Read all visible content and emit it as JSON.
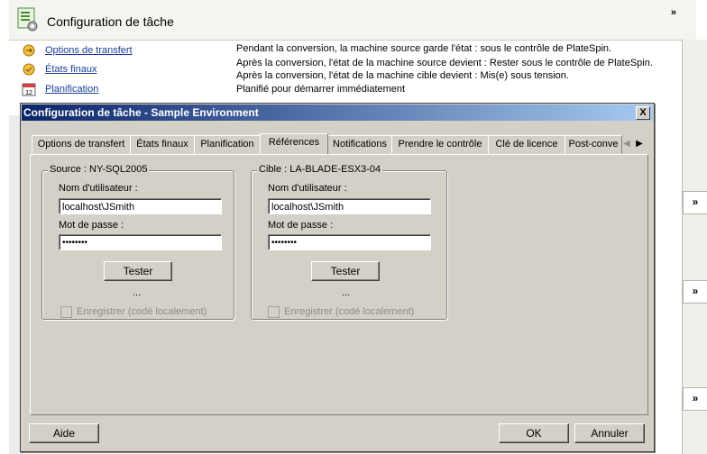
{
  "background": {
    "title": "Configuration de tâche",
    "collapse_icon": "double-chevron-up-icon",
    "rows": [
      {
        "link": "Options de transfert",
        "icon": "transfer-options-icon",
        "desc": [
          "Pendant la conversion, la machine source garde l'état : sous le contrôle de PlateSpin."
        ]
      },
      {
        "link": "États finaux",
        "icon": "end-states-icon",
        "desc": [
          "Après la conversion, l'état de la machine source devient : Rester sous le contrôle de PlateSpin.",
          "Après la conversion, l'état de la machine cible devient : Mis(e) sous tension."
        ]
      },
      {
        "link": "Planification",
        "icon": "calendar-icon",
        "desc": [
          "Planifié pour démarrer immédiatement"
        ]
      }
    ],
    "side_chevron": "»"
  },
  "dialog": {
    "title": "Configuration de tâche - Sample Environment",
    "close_label": "X",
    "tabs": [
      "Options de transfert",
      "États finaux",
      "Planification",
      "Références",
      "Notifications",
      "Prendre le contrôle",
      "Clé de licence",
      "Post-conve"
    ],
    "active_tab": "Références",
    "source": {
      "legend": "Source : NY-SQL2005",
      "user_label": "Nom d'utilisateur :",
      "user_value": "localhost\\JSmith",
      "password_label": "Mot de passe :",
      "password_value": "••••••••",
      "test_label": "Tester",
      "dots": "...",
      "save_label": "Enregistrer (codé localement)"
    },
    "target": {
      "legend": "Cible : LA-BLADE-ESX3-04",
      "user_label": "Nom d'utilisateur :",
      "user_value": "localhost\\JSmith",
      "password_label": "Mot de passe :",
      "password_value": "••••••••",
      "test_label": "Tester",
      "dots": "...",
      "save_label": "Enregistrer (codé localement)"
    },
    "help_label": "Aide",
    "ok_label": "OK",
    "cancel_label": "Annuler"
  }
}
